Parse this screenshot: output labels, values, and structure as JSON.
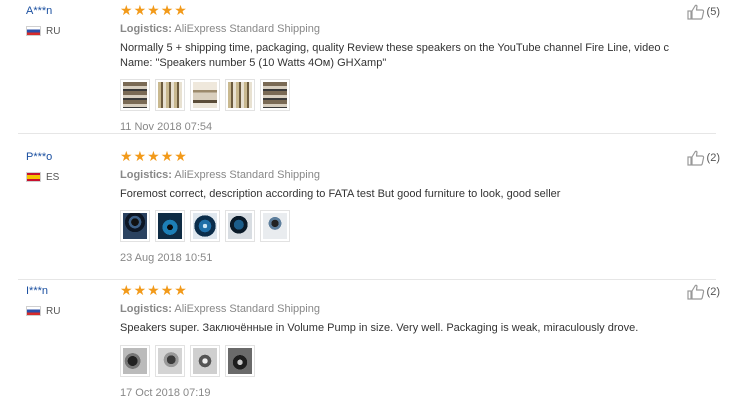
{
  "reviews": [
    {
      "user": "A***n",
      "country": "RU",
      "flag": "russia-flag-icon",
      "rating": 5,
      "logistics_label": "Logistics:",
      "logistics_value": "AliExpress Standard Shipping",
      "text": "Normally 5 + shipping time, packaging, quality Review these speakers on the YouTube channel Fire Line, video c Name: \"Speakers number 5 (10 Watts 4Ом) GHXamp\"",
      "photos": 5,
      "date": "11 Nov 2018 07:54",
      "helpful": "(5)"
    },
    {
      "user": "P***o",
      "country": "ES",
      "flag": "spain-flag-icon",
      "rating": 5,
      "logistics_label": "Logistics:",
      "logistics_value": "AliExpress Standard Shipping",
      "text": "Foremost correct, description according to FATA test But good furniture to look, good seller",
      "photos": 5,
      "date": "23 Aug 2018 10:51",
      "helpful": "(2)"
    },
    {
      "user": "I***n",
      "country": "RU",
      "flag": "russia-flag-icon",
      "rating": 5,
      "logistics_label": "Logistics:",
      "logistics_value": "AliExpress Standard Shipping",
      "text": "Speakers super. Заключённые in Volume Pump in size. Very well. Packaging is weak, miraculously drove.",
      "photos": 4,
      "date": "17 Oct 2018 07:19",
      "helpful": "(2)"
    }
  ],
  "colors": {
    "username": "#1a4fa0",
    "star": "#f29a1a",
    "muted": "#888888",
    "body_text": "#333333",
    "divider": "#e6e6e6"
  },
  "icons": {
    "star": "star-icon",
    "helpful": "thumbs-up-icon"
  }
}
